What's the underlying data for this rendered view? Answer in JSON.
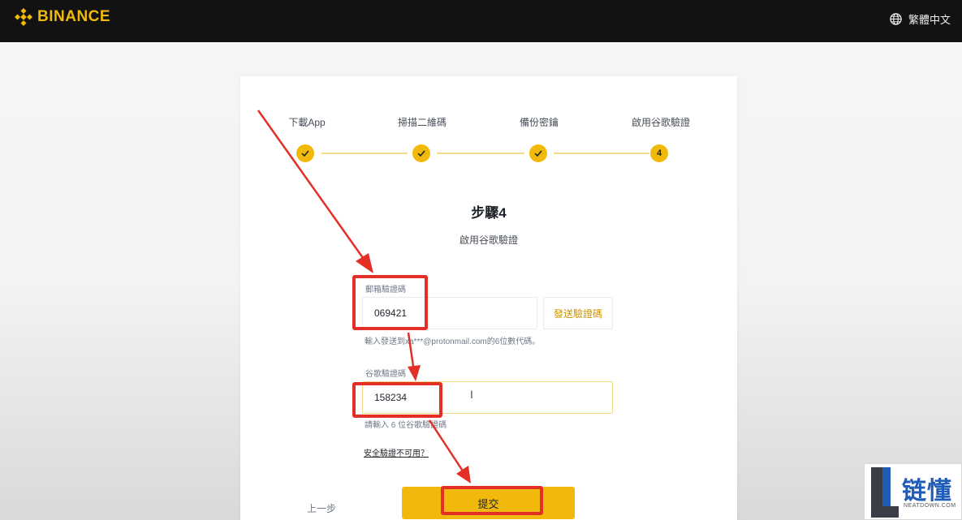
{
  "header": {
    "brand": "BINANCE",
    "language": "繁體中文"
  },
  "steps": [
    {
      "label": "下載App",
      "state": "done"
    },
    {
      "label": "掃描二維碼",
      "state": "done"
    },
    {
      "label": "備份密鑰",
      "state": "done"
    },
    {
      "label": "啟用谷歌驗證",
      "state": "current",
      "number": "4"
    }
  ],
  "main": {
    "title": "步驟4",
    "subtitle": "啟用谷歌驗證"
  },
  "email_code": {
    "label": "郵箱驗證碼",
    "value": "069421",
    "send_button": "發送驗證碼",
    "hint": "輸入發送到xa***@protonmail.com的6位數代碼。"
  },
  "google_code": {
    "label": "谷歌驗證碼",
    "value": "158234",
    "hint": "請輸入 6 位谷歌驗證碼"
  },
  "security_link": "安全驗證不可用？",
  "actions": {
    "back": "上一步",
    "submit": "提交"
  },
  "watermark": {
    "text": "链懂",
    "sub": "NEATDOWN.COM"
  },
  "colors": {
    "brand_yellow": "#f0b90b",
    "header_bg": "#121212",
    "annotation_red": "#e32f26",
    "watermark_blue": "#1f5cb8"
  }
}
